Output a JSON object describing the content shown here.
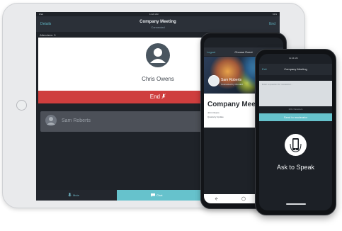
{
  "tablet": {
    "status": {
      "left": "iPad",
      "time": "11:24 AM",
      "battery": "61%"
    },
    "nav": {
      "back_label": "Details",
      "title": "Company Meeting",
      "subtitle": "Connected",
      "end_label": "End"
    },
    "attendees_label": "Attendees: 3",
    "speaker": {
      "name": "Chris Owens"
    },
    "end_bar_label": "End",
    "attendee_row": {
      "name": "Sam Roberts"
    },
    "bottom": {
      "mute_label": "Mute",
      "chat_label": "Chat"
    }
  },
  "phone1": {
    "nav": {
      "left_label": "Logout",
      "title": "Choose Event"
    },
    "hero": {
      "name": "Sam Roberts",
      "role": "Connected by Chorded"
    },
    "card": {
      "title": "Company Meeting",
      "line1": "John Owens",
      "line2": "Quarterly Update"
    }
  },
  "phone2": {
    "status": {
      "carrier": "",
      "time": "11:24 AM",
      "battery": ""
    },
    "nav": {
      "left_label": "Exit",
      "title": "Company Meeting"
    },
    "input_placeholder": "Enter a question for moderator...",
    "counter": "200 characters",
    "send_label": "Send to moderator",
    "ask_label": "Ask to Speak"
  },
  "colors": {
    "accent": "#66c2cc",
    "end_red": "#cf3e3e",
    "dark_bg": "#1f2329"
  }
}
